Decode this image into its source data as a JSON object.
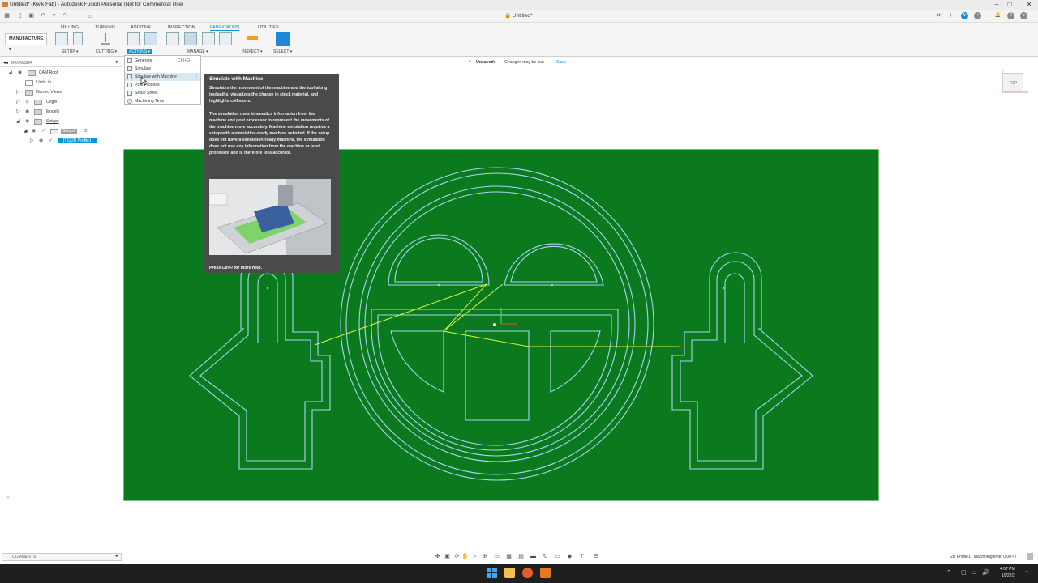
{
  "window": {
    "title": "Untitled* (Kwik Fab) - Autodesk Fusion Personal (Not for Commercial Use)",
    "controls": [
      "–",
      "□",
      "✕"
    ]
  },
  "doc_tab": {
    "label": "Untitled*"
  },
  "ribbon": {
    "tabs": [
      "MILLING",
      "TURNING",
      "ADDITIVE",
      "INSPECTION",
      "FABRICATION",
      "UTILITIES"
    ],
    "active_tab": "FABRICATION",
    "workspace": "MANUFACTURE",
    "groups": [
      "SETUP",
      "CUTTING",
      "ACTIONS",
      "MANAGE",
      "INSPECT",
      "SELECT"
    ],
    "active_group": "ACTIONS"
  },
  "actions_menu": {
    "items": [
      {
        "label": "Generate",
        "shortcut": "Ctrl+G"
      },
      {
        "label": "Simulate",
        "shortcut": ""
      },
      {
        "label": "Simulate with Machine",
        "shortcut": ""
      },
      {
        "label": "Post Process",
        "shortcut": ""
      },
      {
        "label": "Setup Sheet",
        "shortcut": ""
      },
      {
        "label": "Machining Time",
        "shortcut": ""
      }
    ],
    "highlighted": "Simulate with Machine"
  },
  "tooltip": {
    "title": "Simulate with Machine",
    "para1": "Simulates the movement of the machine and the tool along toolpaths, visualizes the change in stock material, and highlights collisions.",
    "para2": "The simulation uses kinematics information from the machine and post processor to represent the movements of the machine more accurately. Machine simulation requires a setup with a simulation-ready machine selected. If the setup does not have a simulation-ready machine, the simulation does not use any information from the machine or post processor and is therefore less accurate.",
    "help": "Press Ctrl+/ for more help."
  },
  "browser": {
    "header": "BROWSER",
    "items": [
      {
        "label": "CAM Root"
      },
      {
        "label": "Units: in"
      },
      {
        "label": "Named Views"
      },
      {
        "label": "Origin"
      },
      {
        "label": "Models"
      },
      {
        "label": "Setups"
      },
      {
        "label": "Setup1"
      },
      {
        "label": "[T1] 2D Profile1"
      }
    ]
  },
  "banner": {
    "unsaved": "Unsaved:",
    "message": "Changes may be lost",
    "save": "Save"
  },
  "viewcube": {
    "face": "TOP"
  },
  "comments": {
    "label": "COMMENTS"
  },
  "status": {
    "text": "2D Profile1 | Machining time: 0:00:47"
  },
  "taskbar": {
    "time": "4:07 PM",
    "date": "10/22/2"
  },
  "colors": {
    "stock_green": "#0b7a1f",
    "toolpath_blue": "#a9d4f2",
    "rapid_yellow": "#d8f53a",
    "accent": "#0696d7"
  }
}
